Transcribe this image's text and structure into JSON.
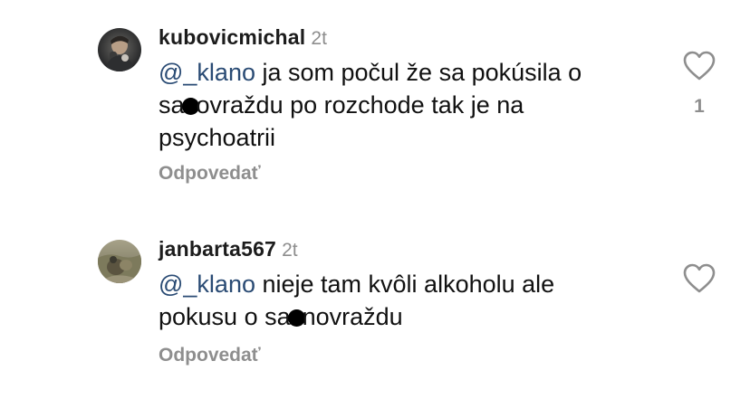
{
  "comments": [
    {
      "username": "kubovicmichal",
      "time": "2t",
      "mention": "@_klano",
      "text_line1": " ja som počul že sa pokúsila o",
      "text_line2_before": "sa",
      "text_line2_after": "ovraždu po rozchode tak je na",
      "text_line3": "psychoatrii",
      "reply_label": "Odpovedať",
      "like_count": "1",
      "avatar_icon": "profile-photo",
      "like_icon": "heart-outline-icon"
    },
    {
      "username": "janbarta567",
      "time": "2t",
      "mention": "@_klano",
      "text_line1": " nieje tam kvôli alkoholu ale",
      "text_line2_before": "pokusu o sa",
      "text_line2_after": "novraždu",
      "reply_label": "Odpovedať",
      "avatar_icon": "profile-photo",
      "like_icon": "heart-outline-icon"
    }
  ],
  "colors": {
    "mention": "#2a4b74",
    "secondary_text": "#8e8e8e",
    "username": "#1c1c1c"
  }
}
